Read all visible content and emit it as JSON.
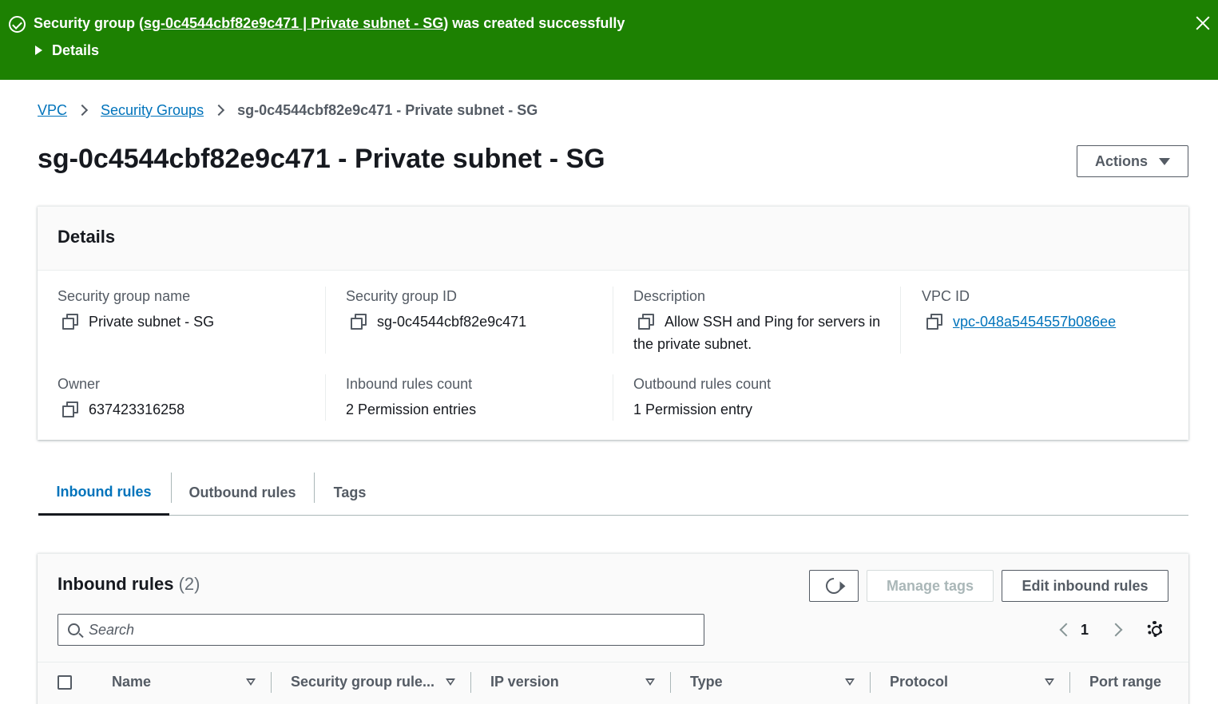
{
  "flash": {
    "message_prefix": "Security group (",
    "message_link": "sg-0c4544cbf82e9c471 | Private subnet - SG",
    "message_suffix": ") was created successfully",
    "details_label": "Details"
  },
  "breadcrumb": {
    "items": [
      "VPC",
      "Security Groups"
    ],
    "current": "sg-0c4544cbf82e9c471 - Private subnet - SG"
  },
  "page": {
    "title": "sg-0c4544cbf82e9c471 - Private subnet - SG",
    "actions_label": "Actions"
  },
  "details": {
    "title": "Details",
    "fields": {
      "sg_name": {
        "label": "Security group name",
        "value": "Private subnet - SG"
      },
      "sg_id": {
        "label": "Security group ID",
        "value": "sg-0c4544cbf82e9c471"
      },
      "description": {
        "label": "Description",
        "value": "Allow SSH and Ping for servers in the private subnet."
      },
      "vpc_id": {
        "label": "VPC ID",
        "value": "vpc-048a5454557b086ee"
      },
      "owner": {
        "label": "Owner",
        "value": "637423316258"
      },
      "inbound_count": {
        "label": "Inbound rules count",
        "value": "2 Permission entries"
      },
      "outbound_count": {
        "label": "Outbound rules count",
        "value": "1 Permission entry"
      }
    }
  },
  "tabs": [
    "Inbound rules",
    "Outbound rules",
    "Tags"
  ],
  "inbound": {
    "title": "Inbound rules",
    "count": "(2)",
    "manage_tags_label": "Manage tags",
    "edit_label": "Edit inbound rules",
    "search_placeholder": "Search",
    "page_number": "1",
    "columns": [
      "Name",
      "Security group rule...",
      "IP version",
      "Type",
      "Protocol",
      "Port range"
    ]
  },
  "colors": {
    "success": "#1d8102",
    "link": "#0073bb",
    "text": "#16191f",
    "secondary_text": "#545b64"
  }
}
